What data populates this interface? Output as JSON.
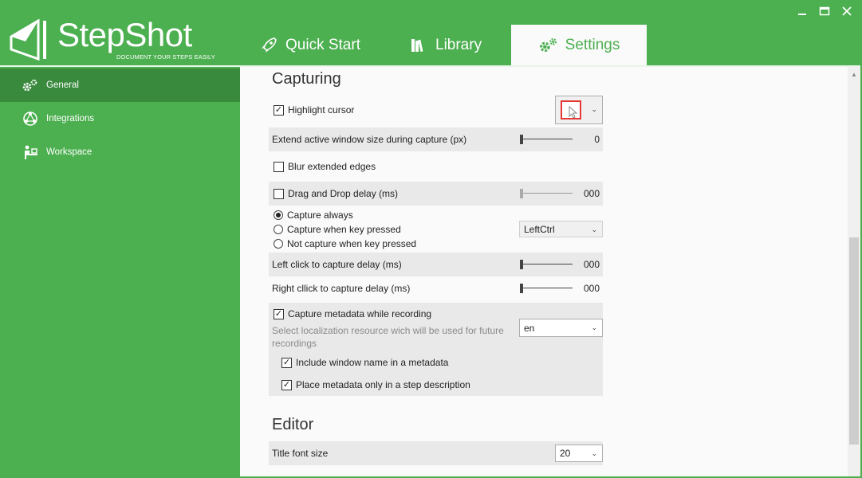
{
  "app": {
    "name": "StepShot",
    "tagline": "DOCUMENT YOUR STEPS EASILY"
  },
  "tabs": [
    {
      "label": "Quick Start",
      "icon": "rocket-icon"
    },
    {
      "label": "Library",
      "icon": "books-icon"
    },
    {
      "label": "Settings",
      "icon": "gears-icon",
      "active": true
    }
  ],
  "sidebar": {
    "items": [
      {
        "label": "General",
        "icon": "gears-icon",
        "active": true
      },
      {
        "label": "Integrations",
        "icon": "network-icon"
      },
      {
        "label": "Workspace",
        "icon": "person-desk-icon"
      }
    ]
  },
  "capturing": {
    "title": "Capturing",
    "highlight_cursor": {
      "label": "Highlight cursor",
      "checked": true
    },
    "extend_window": {
      "label": "Extend active window size during capture (px)",
      "value": "0"
    },
    "blur_edges": {
      "label": "Blur extended edges",
      "checked": false
    },
    "drag_drop_delay": {
      "label": "Drag and Drop delay (ms)",
      "value": "000",
      "checked": false
    },
    "capture_mode": {
      "options": [
        "Capture always",
        "Capture when key pressed",
        "Not capture when key pressed"
      ],
      "selected": "Capture always",
      "key": "LeftCtrl"
    },
    "left_click_delay": {
      "label": "Left click to capture delay (ms)",
      "value": "000"
    },
    "right_click_delay": {
      "label": "Right cllick to capture delay (ms)",
      "value": "000"
    },
    "metadata": {
      "label": "Capture metadata while recording",
      "checked": true,
      "localization_label": "Select localization resource wich will be used for future recordings",
      "localization_value": "en",
      "include_window_name": {
        "label": "Include window name in a metadata",
        "checked": true
      },
      "place_in_description": {
        "label": "Place metadata only in a step description",
        "checked": true
      }
    }
  },
  "editor": {
    "title": "Editor",
    "title_font_size": {
      "label": "Title font size",
      "value": "20"
    }
  },
  "colors": {
    "brand": "#4caf50",
    "highlight_frame": "#e53935"
  }
}
